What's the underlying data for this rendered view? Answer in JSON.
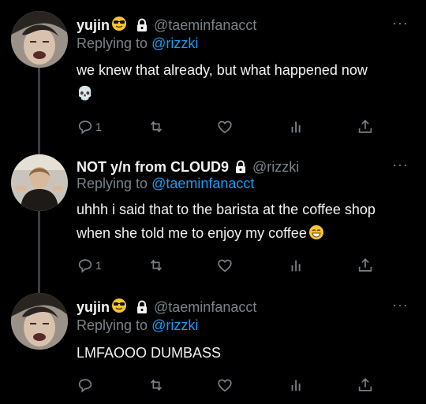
{
  "tweets": [
    {
      "name": "yujin",
      "handle": "@taeminfanacct",
      "reply_prefix": "Replying to ",
      "reply_to": "@rizzki",
      "text": "we knew that already, but what happened now",
      "emoji_line": "💀",
      "reply_count": "1",
      "more": "···"
    },
    {
      "name": "NOT y/n from CLOUD9",
      "handle": "@rizzki",
      "reply_prefix": "Replying to ",
      "reply_to": "@taeminfanacct",
      "text": "uhhh i said that to the barista at the coffee shop when she told me to enjoy my coffee",
      "reply_count": "1",
      "more": "···"
    },
    {
      "name": "yujin",
      "handle": "@taeminfanacct",
      "reply_prefix": "Replying to ",
      "reply_to": "@rizzki",
      "text": "LMFAOOO DUMBASS",
      "reply_count": "",
      "more": "···"
    }
  ],
  "colors": {
    "background": "#000000",
    "text": "#f2f2f2",
    "muted": "#7a8288",
    "link": "#1d9bf0",
    "thread_line": "#3a3f44"
  },
  "icons": [
    "sunglasses-emoji",
    "lock-icon",
    "skull-emoji",
    "grinning-emoji",
    "reply-icon",
    "retweet-icon",
    "like-icon",
    "analytics-icon",
    "share-icon"
  ]
}
